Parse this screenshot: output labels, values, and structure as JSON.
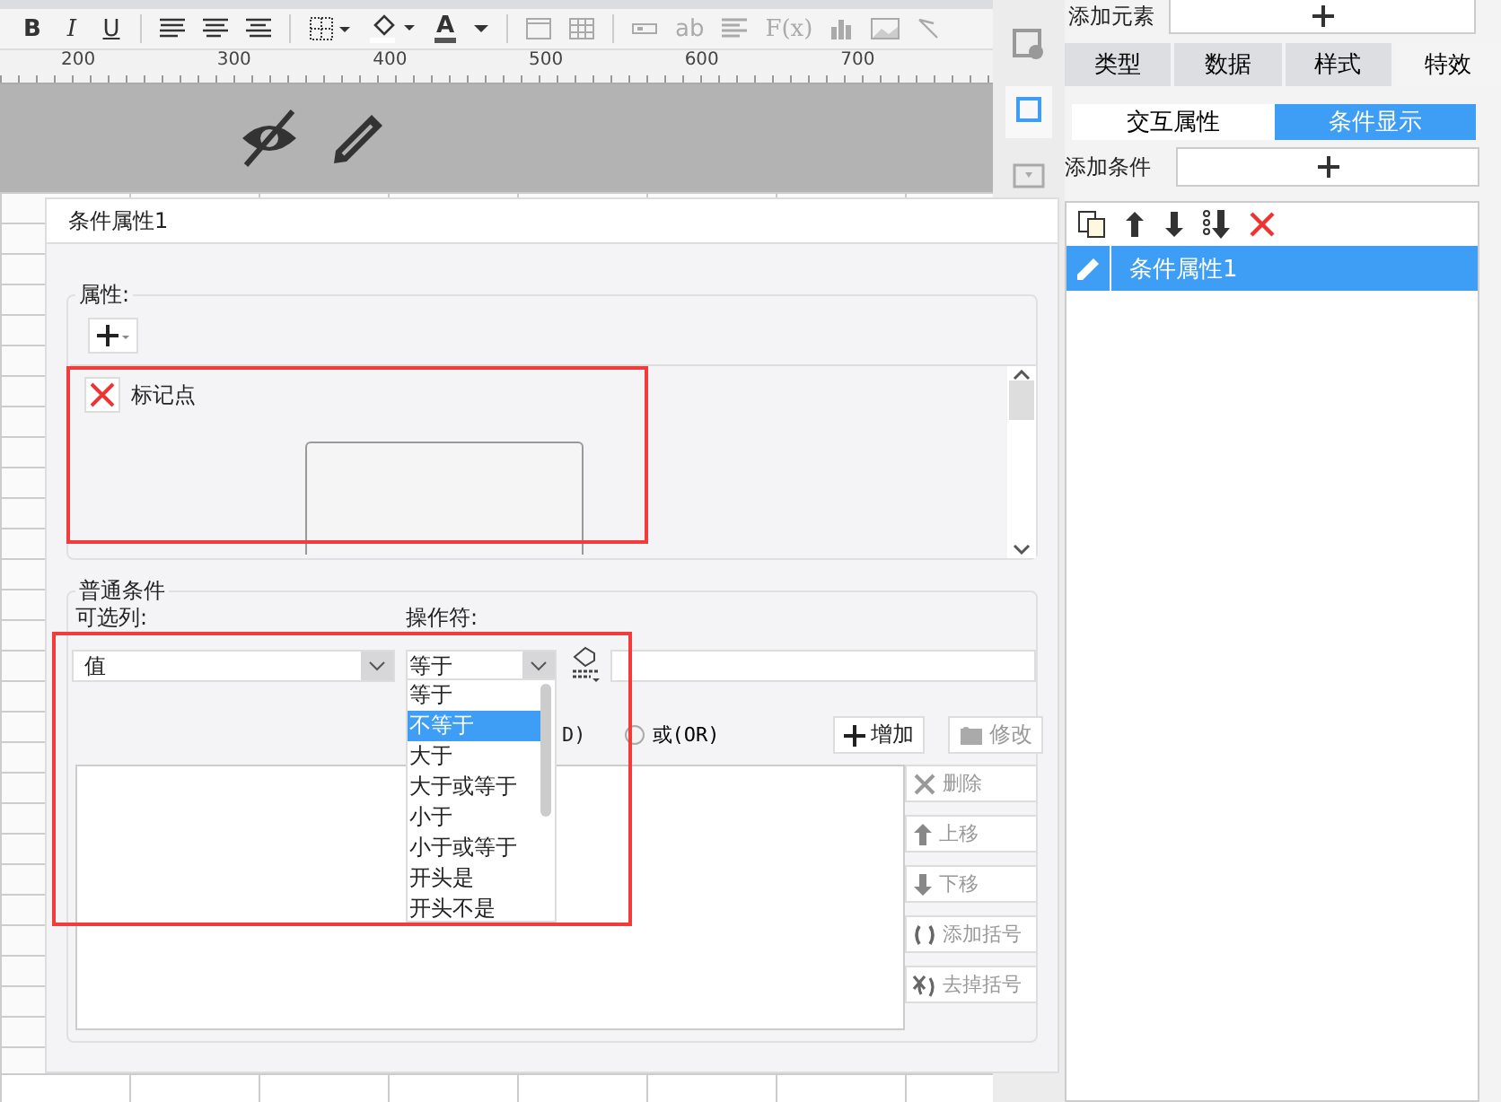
{
  "toolbar": {
    "format_buttons": [
      "B",
      "I",
      "U"
    ],
    "font_color_glyph": "A",
    "text_glyph": "ab",
    "formula_glyph": "F(x)"
  },
  "ruler": {
    "labels": [
      "200",
      "300",
      "400",
      "500",
      "600",
      "700"
    ]
  },
  "side_panel": {
    "add_element_label": "添加元素",
    "tabs": [
      {
        "label": "类型",
        "selected": false
      },
      {
        "label": "数据",
        "selected": false
      },
      {
        "label": "样式",
        "selected": false
      },
      {
        "label": "特效",
        "selected": true
      }
    ],
    "subtabs": [
      {
        "label": "交互属性",
        "selected": false
      },
      {
        "label": "条件显示",
        "selected": true
      }
    ],
    "add_condition_label": "添加条件",
    "conditions": [
      {
        "label": "条件属性1",
        "selected": true
      }
    ]
  },
  "dialog": {
    "title": "条件属性1",
    "attributes": {
      "legend": "属性:",
      "items": [
        {
          "label": "标记点"
        }
      ]
    },
    "common_conditions": {
      "legend": "普通条件",
      "column_label": "可选列:",
      "column_value": "值",
      "operator_label": "操作符:",
      "operator_value": "等于",
      "radios": [
        {
          "label": "D)"
        },
        {
          "label": "或(OR)",
          "selected": false
        }
      ],
      "add_button": {
        "label": "增加",
        "disabled": false
      },
      "modify_button": {
        "label": "修改",
        "disabled": true
      },
      "side_buttons": [
        {
          "kind": "delete",
          "label": "删除",
          "disabled": true
        },
        {
          "kind": "up",
          "label": "上移",
          "disabled": true
        },
        {
          "kind": "down",
          "label": "下移",
          "disabled": true
        },
        {
          "kind": "add-bracket",
          "label": "添加括号",
          "disabled": true
        },
        {
          "kind": "remove-bracket",
          "label": "去掉括号",
          "disabled": true
        }
      ]
    },
    "operator_options": [
      {
        "label": "等于",
        "selected": false
      },
      {
        "label": "不等于",
        "selected": true
      },
      {
        "label": "大于",
        "selected": false
      },
      {
        "label": "大于或等于",
        "selected": false
      },
      {
        "label": "小于",
        "selected": false
      },
      {
        "label": "小于或等于",
        "selected": false
      },
      {
        "label": "开头是",
        "selected": false
      },
      {
        "label": "开头不是",
        "selected": false
      }
    ]
  }
}
